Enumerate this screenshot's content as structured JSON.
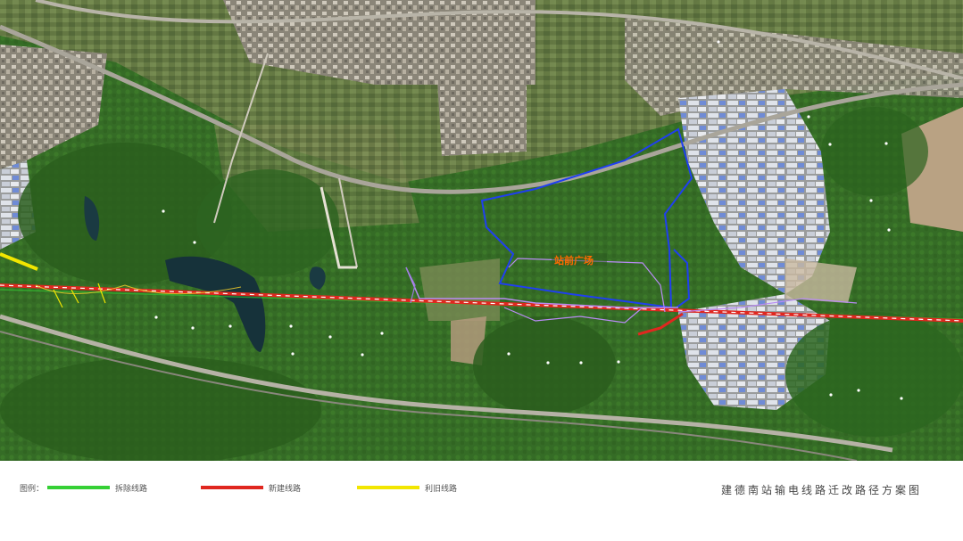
{
  "map": {
    "label_plaza": "站前广场",
    "colors": {
      "red_line": "#e0271f",
      "green_line": "#35d035",
      "yellow_line": "#f2e600",
      "blue_boundary": "#1f3ff0",
      "purple_lines": "#b98bf5"
    }
  },
  "legend": {
    "title": "图例：",
    "items": [
      {
        "label": "拆除线路",
        "color": "#35d035"
      },
      {
        "label": "新建线路",
        "color": "#e0271f"
      },
      {
        "label": "利旧线路",
        "color": "#f2e600"
      }
    ]
  },
  "title": "建德南站输电线路迁改路径方案图"
}
